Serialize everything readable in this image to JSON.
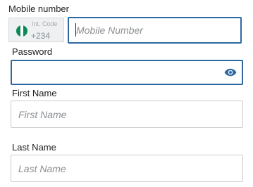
{
  "mobile": {
    "label": "Mobile number",
    "code_caption": "Int. Code",
    "code_value": "+234",
    "flag_icon": "nigeria-flag-icon",
    "placeholder": "Mobile Number",
    "value": ""
  },
  "password": {
    "label": "Password",
    "value": "",
    "toggle_icon": "eye-icon"
  },
  "first_name": {
    "label": "First Name",
    "placeholder": "First Name",
    "value": ""
  },
  "last_name": {
    "label": "Last Name",
    "placeholder": "Last Name",
    "value": ""
  },
  "colors": {
    "focus_border": "#2f69a1",
    "eye_icon": "#2f69a1",
    "flag_green": "#0b8a55"
  }
}
